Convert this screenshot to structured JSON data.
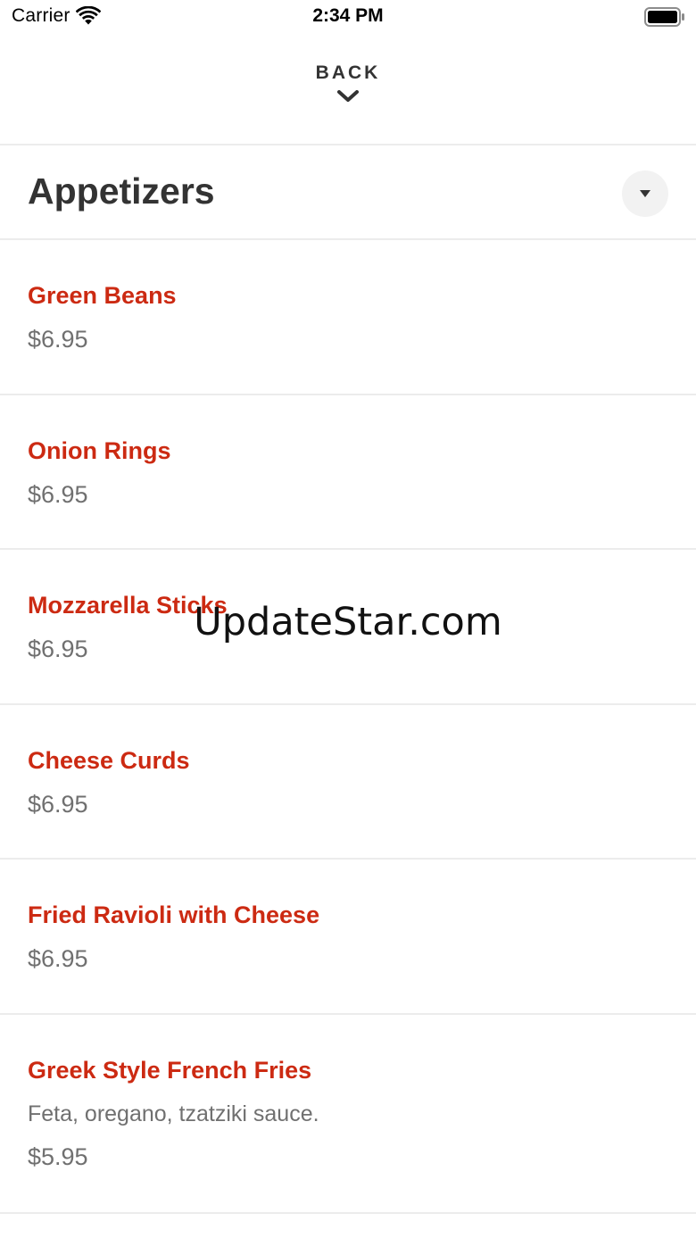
{
  "status_bar": {
    "carrier": "Carrier",
    "time": "2:34 PM",
    "wifi_icon": "wifi-icon",
    "battery_icon": "battery-full-icon"
  },
  "header": {
    "back_label": "BACK",
    "back_icon": "chevron-down-icon"
  },
  "category": {
    "title": "Appetizers",
    "dropdown_icon": "caret-down-icon"
  },
  "menu": {
    "items": [
      {
        "name": "Green Beans",
        "description": "",
        "price": "$6.95"
      },
      {
        "name": "Onion Rings",
        "description": "",
        "price": "$6.95"
      },
      {
        "name": "Mozzarella Sticks",
        "description": "",
        "price": "$6.95"
      },
      {
        "name": "Cheese Curds",
        "description": "",
        "price": "$6.95"
      },
      {
        "name": "Fried Ravioli with Cheese",
        "description": "",
        "price": "$6.95"
      },
      {
        "name": "Greek Style French Fries",
        "description": "Feta, oregano, tzatziki sauce.",
        "price": "$5.95"
      }
    ]
  },
  "watermark": "UpdateStar.com",
  "colors": {
    "accent": "#cc2a12",
    "text_primary": "#333333",
    "text_secondary": "#707070",
    "divider": "#ececec"
  }
}
